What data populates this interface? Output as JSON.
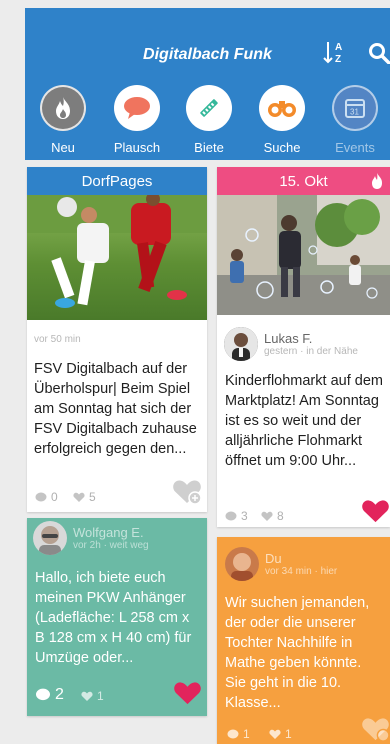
{
  "header": {
    "title": "Digitalbach Funk",
    "sort_icon": "sort-az-icon",
    "search_icon": "search-icon"
  },
  "categories": [
    {
      "label": "Neu",
      "icon": "fire-icon",
      "color": "#7d7d7d"
    },
    {
      "label": "Plausch",
      "icon": "chat-bubble-icon",
      "color": "#f0745e"
    },
    {
      "label": "Biete",
      "icon": "tool-icon",
      "color": "#34b89a"
    },
    {
      "label": "Suche",
      "icon": "binoculars-icon",
      "color": "#f38b2a"
    },
    {
      "label": "Events",
      "icon": "calendar-icon",
      "color": "#6a8fc7"
    }
  ],
  "cards": {
    "dorfpages": {
      "header": "DorfPages",
      "time": "vor 50 min",
      "text": "FSV Digitalbach auf der Überholspur| Beim Spiel am Sonntag hat sich der FSV Digitalbach zuhause erfolgreich gegen den...",
      "comments": "0",
      "likes": "5"
    },
    "event": {
      "header": "15. Okt",
      "author": "Lukas F.",
      "meta": "gestern · in der Nähe",
      "text": "Kinderflohmarkt auf dem Marktplatz! Am Sonntag ist es so weit und der alljährliche Flohmarkt öffnet um 9:00 Uhr...",
      "comments": "3",
      "likes": "8"
    },
    "offer": {
      "author": "Wolfgang E.",
      "meta": "vor 2h · weit weg",
      "text": "Hallo, ich biete euch meinen PKW Anhänger (Ladefläche: L 258 cm x B 128 cm x H 40 cm) für Umzüge oder...",
      "comments": "2",
      "likes": "1"
    },
    "search": {
      "author": "Du",
      "meta": "vor 34 min · hier",
      "text": "Wir suchen jemanden, der oder die unserer Tochter Nachhilfe in Mathe geben könnte. Sie geht in die 10. Klasse...",
      "comments": "1",
      "likes": "1"
    }
  }
}
